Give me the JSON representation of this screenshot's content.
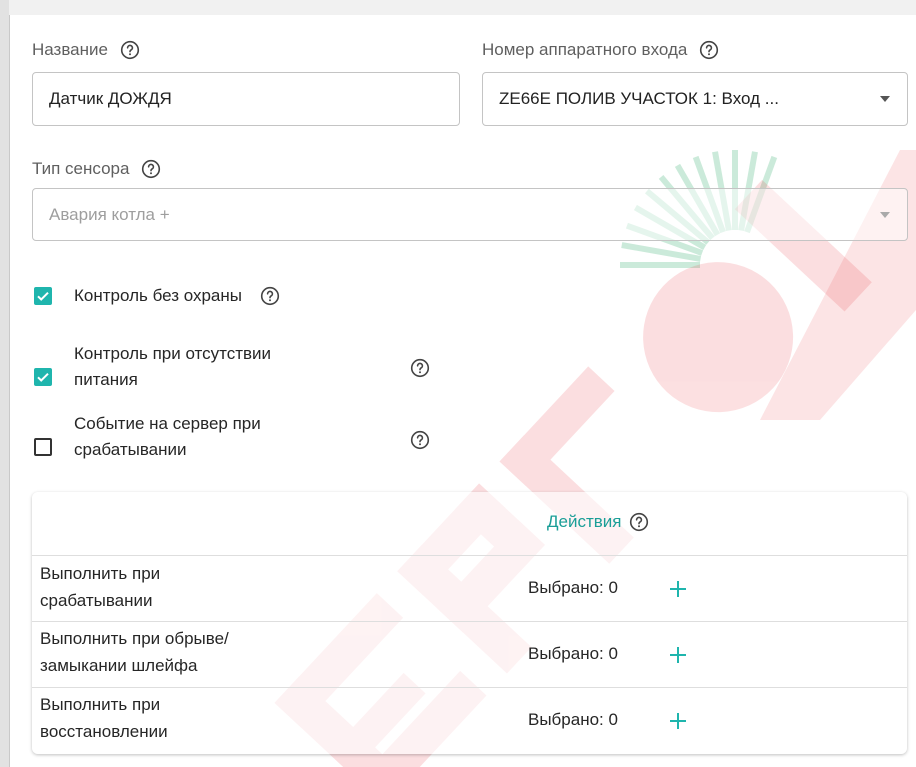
{
  "form": {
    "name_label": "Название",
    "name_value": "Датчик ДОЖДЯ",
    "input_label": "Номер аппаратного входа",
    "input_value": "ZE66E ПОЛИВ УЧАСТОК 1: Вход ...",
    "sensor_type_label": "Тип сенсора",
    "sensor_type_placeholder": "Авария котла +"
  },
  "checkboxes": [
    {
      "label": "Контроль без охраны",
      "checked": true
    },
    {
      "label_lines": [
        "Контроль при отсутствии",
        "питания"
      ],
      "checked": true
    },
    {
      "label_lines": [
        "Событие на сервер при",
        "срабатывании"
      ],
      "checked": false
    }
  ],
  "actions": {
    "title": "Действия",
    "rows": [
      {
        "label_lines": [
          "Выполнить при",
          "срабатывании"
        ],
        "count": "Выбрано: 0"
      },
      {
        "label_lines": [
          "Выполнить при обрыве/",
          "замыкании шлейфа"
        ],
        "count": "Выбрано: 0"
      },
      {
        "label_lines": [
          "Выполнить при",
          "восстановлении"
        ],
        "count": "Выбрано: 0"
      }
    ]
  },
  "colors": {
    "accent": "#1fb5ad",
    "accent_text": "#1a9e97",
    "watermark_red": "#e8202a",
    "watermark_green": "#18a55a"
  },
  "icons": {
    "help": "question-circle-icon",
    "dropdown": "caret-down-icon",
    "add": "plus-icon",
    "check": "check-icon",
    "watermark": "brand-sun-logo"
  }
}
